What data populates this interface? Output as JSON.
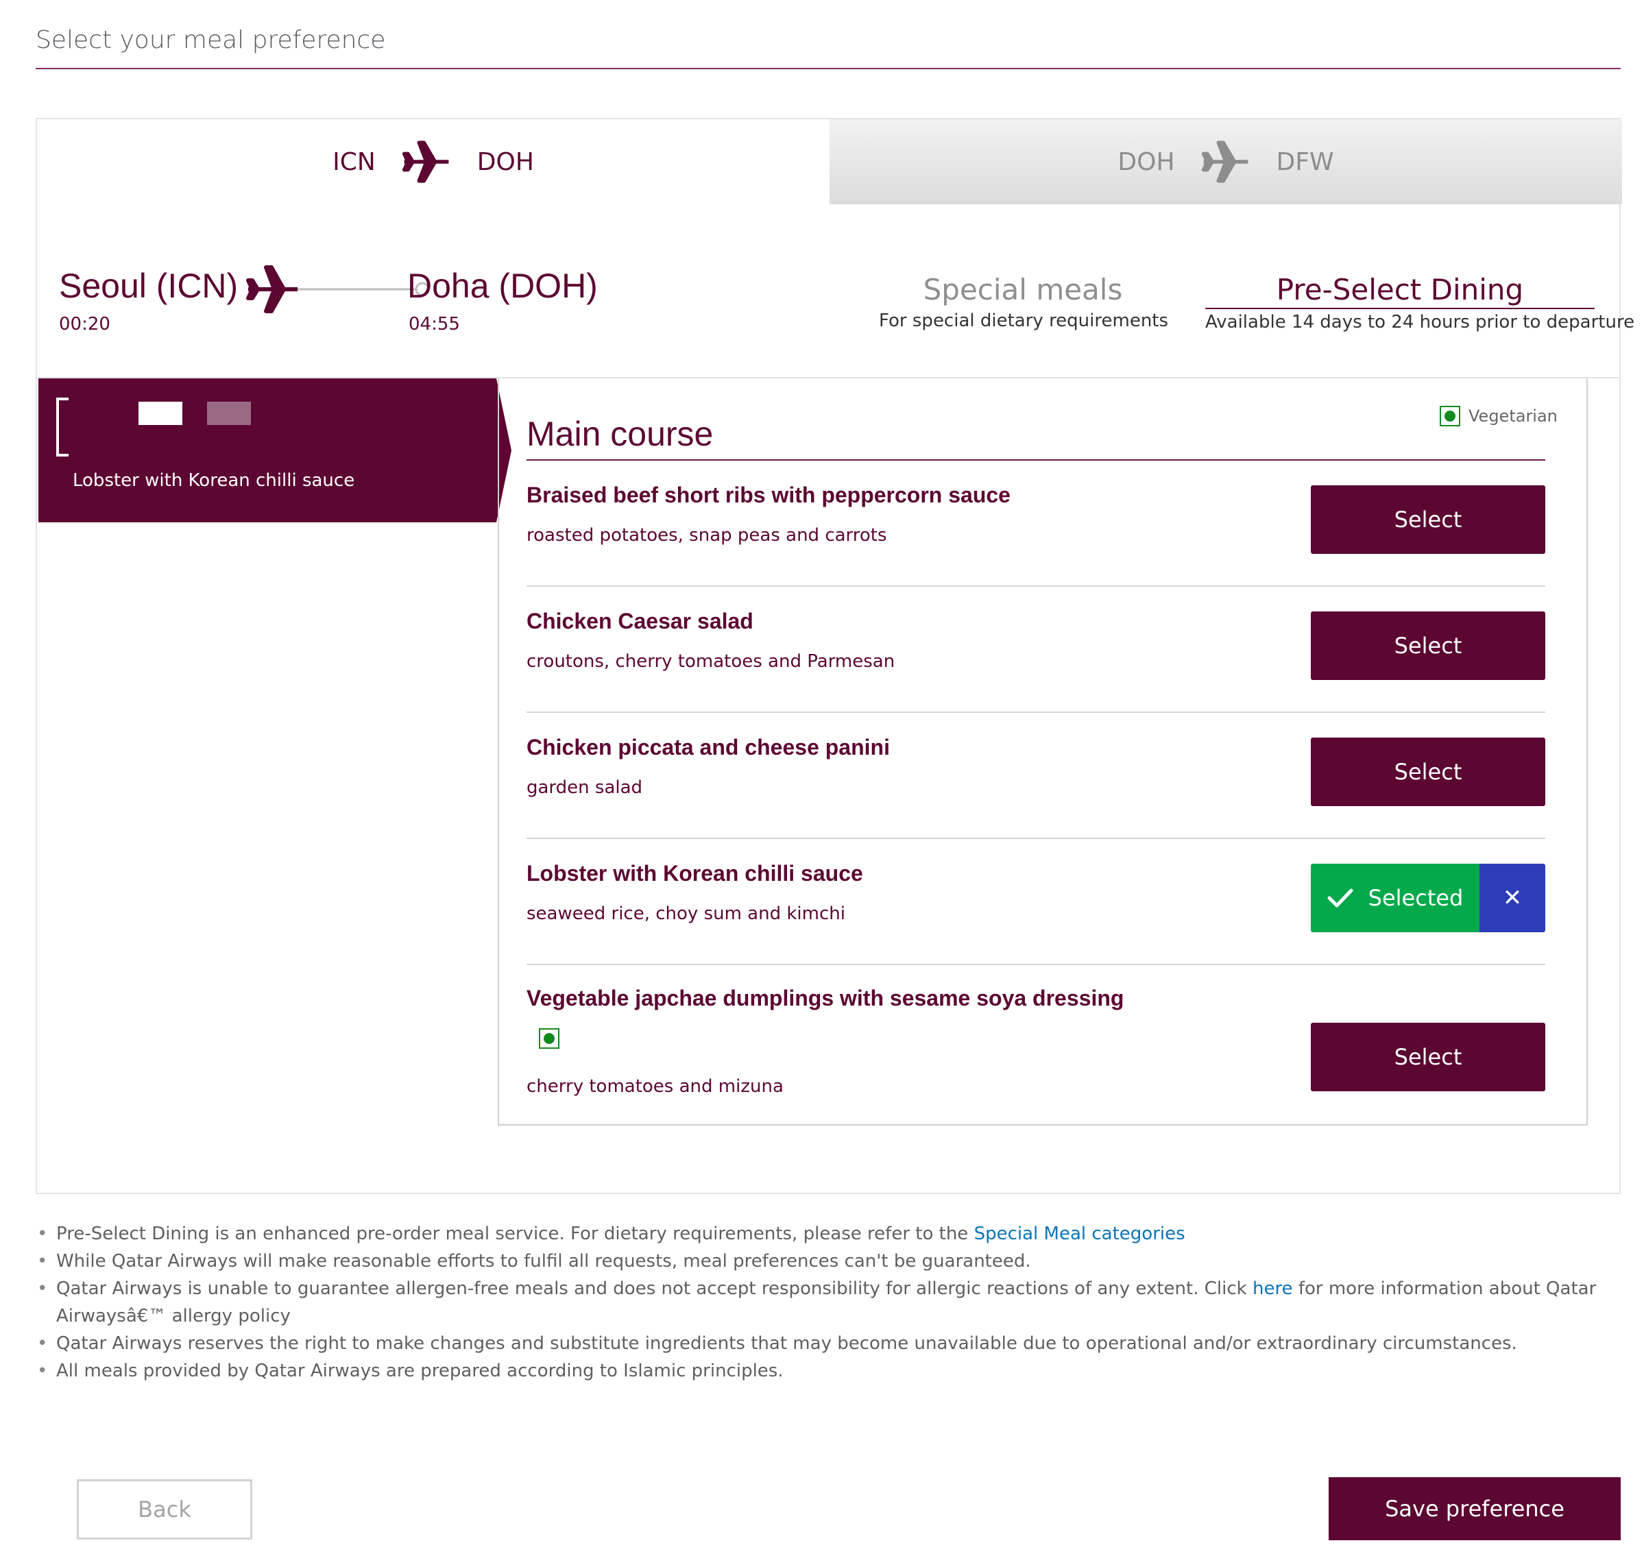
{
  "page": {
    "title": "Select your meal preference"
  },
  "legs": [
    {
      "from": "ICN",
      "to": "DOH"
    },
    {
      "from": "DOH",
      "to": "DFW"
    }
  ],
  "flight": {
    "origin": "Seoul (ICN)",
    "destination": "Doha (DOH)",
    "depart_time": "00:20",
    "arrive_time": "04:55"
  },
  "dining_tabs": [
    {
      "title": "Special meals",
      "subtitle": "For special dietary requirements"
    },
    {
      "title": "Pre-Select Dining",
      "subtitle": "Available 14 days to 24 hours prior to departure"
    }
  ],
  "course_nav": {
    "selected_dish": "Lobster with Korean chilli sauce"
  },
  "legend": {
    "vegetarian": "Vegetarian"
  },
  "course": {
    "title": "Main course",
    "select_label": "Select",
    "selected_label": "Selected",
    "remove_glyph": "✕",
    "dishes": [
      {
        "name": "Braised beef short ribs with peppercorn sauce",
        "description": "roasted potatoes, snap peas and carrots",
        "vegetarian": false,
        "selected": false
      },
      {
        "name": "Chicken Caesar salad",
        "description": "croutons, cherry tomatoes and Parmesan",
        "vegetarian": false,
        "selected": false
      },
      {
        "name": "Chicken piccata and cheese panini",
        "description": "garden salad",
        "vegetarian": false,
        "selected": false
      },
      {
        "name": "Lobster with Korean chilli sauce",
        "description": "seaweed rice, choy sum and kimchi",
        "vegetarian": false,
        "selected": true
      },
      {
        "name": "Vegetable japchae dumplings with sesame soya dressing",
        "description": "cherry tomatoes and mizuna",
        "vegetarian": true,
        "selected": false
      }
    ]
  },
  "notes": {
    "n1_text": "Pre-Select Dining is an enhanced pre-order meal service. For dietary requirements, please refer to the ",
    "n1_link": "Special Meal categories",
    "n2": "While Qatar Airways will make reasonable efforts to fulfil all requests, meal preferences can't be guaranteed.",
    "n3_text": "Qatar Airways is unable to guarantee allergen-free meals and does not accept responsibility for allergic reactions of any extent. Click ",
    "n3_link": "here",
    "n3_tail": " for more information about Qatar Airwaysâ€™ allergy policy",
    "n4": "Qatar Airways reserves the right to make changes and substitute ingredients that may become unavailable due to operational and/or extraordinary circumstances.",
    "n5": "All meals provided by Qatar Airways are prepared according to Islamic principles."
  },
  "footer": {
    "back_label": "Back",
    "save_label": "Save preference"
  },
  "colors": {
    "brand": "#5c0632",
    "selected": "#04a94c",
    "remove": "#2c3db7",
    "vegetarian": "#118a1e",
    "link": "#0a74ba"
  }
}
